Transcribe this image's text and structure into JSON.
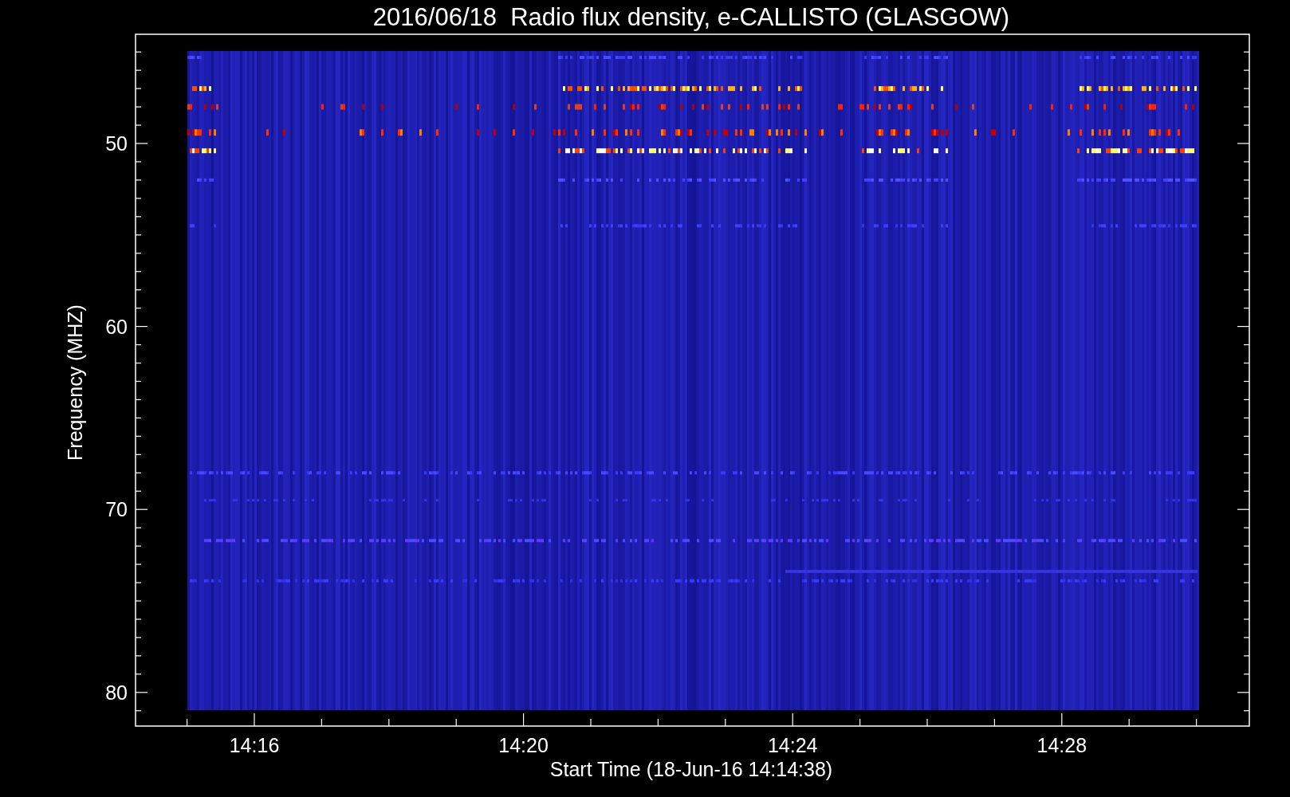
{
  "title": "2016/06/18  Radio flux density, e-CALLISTO (GLASGOW)",
  "y_axis": {
    "label": "Frequency (MHZ)",
    "tick_labels": [
      "50",
      "60",
      "70",
      "80"
    ]
  },
  "x_axis": {
    "label": "Start Time (18-Jun-16 14:14:38)",
    "tick_labels": [
      "14:16",
      "14:20",
      "14:24",
      "14:28"
    ]
  }
}
